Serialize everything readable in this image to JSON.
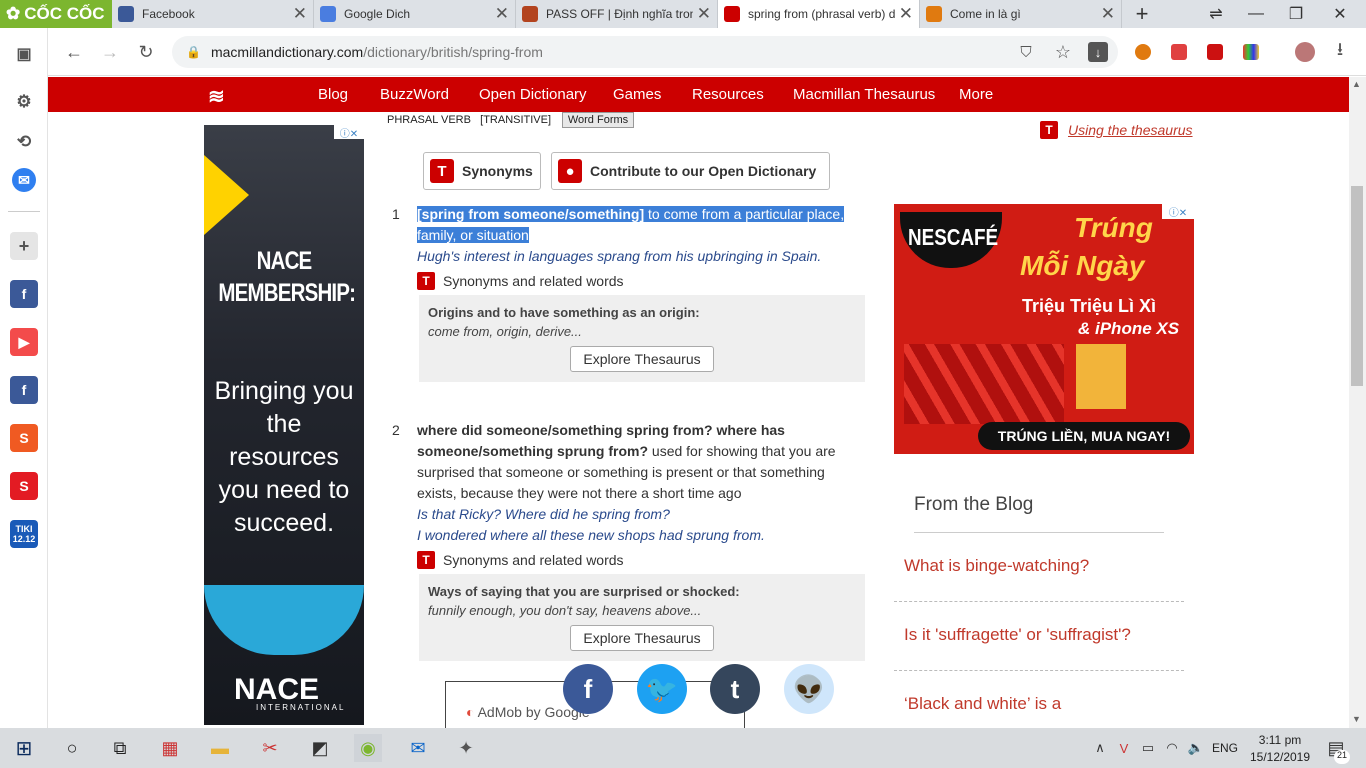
{
  "browser": {
    "brand": "CỐC CỐC",
    "tabs": [
      {
        "title": "Facebook",
        "active": false
      },
      {
        "title": "Google Dich",
        "active": false
      },
      {
        "title": "PASS OFF | Định nghĩa trong",
        "active": false
      },
      {
        "title": "spring from (phrasal verb) d",
        "active": true
      },
      {
        "title": "Come in là gì",
        "active": false
      }
    ],
    "new_tab": "+",
    "url_host": "macmillandictionary.com",
    "url_path": "/dictionary/british/spring-from"
  },
  "nav": {
    "items": [
      "Blog",
      "BuzzWord",
      "Open Dictionary",
      "Games",
      "Resources",
      "Macmillan Thesaurus",
      "More"
    ]
  },
  "entry": {
    "part_of_speech": "PHRASAL VERB",
    "grammar": "[TRANSITIVE]",
    "word_forms": "Word Forms",
    "synonyms_btn": "Synonyms",
    "contribute_btn": "Contribute to our Open Dictionary",
    "using_thesaurus": "Using the thesaurus",
    "senses": [
      {
        "num": "1",
        "pattern": "[spring from someone/something]",
        "definition": " to come from a particular place, family, or situation",
        "examples": [
          "Hugh's interest in languages sprang from his upbringing in Spain."
        ],
        "synonyms_label": "Synonyms and related words",
        "thesaurus_head": "Origins and to have something as an origin:",
        "thesaurus_words": "come from, origin, derive...",
        "explore": "Explore Thesaurus"
      },
      {
        "num": "2",
        "pattern_a": "where did someone/something spring from? where has",
        "pattern_b": "someone/something sprung from?",
        "definition_a": " used for showing that you are",
        "definition_b": "surprised that someone or something is present or that something",
        "definition_c": "exists, because they were not there a short time ago",
        "examples": [
          "Is that Ricky? Where did he spring from?",
          "I wondered where all these new shops had sprung from."
        ],
        "synonyms_label": "Synonyms and related words",
        "thesaurus_head": "Ways of saying that you are surprised or shocked:",
        "thesaurus_words": "funnily enough, you don't say, heavens above...",
        "explore": "Explore Thesaurus"
      }
    ]
  },
  "ad_left": {
    "headline": "NACE MEMBERSHIP:",
    "body": "Bringing you the resources you need to succeed.",
    "logo": "NACE",
    "logo_sub": "INTERNATIONAL"
  },
  "ad_right": {
    "brand": "NESCAFÉ",
    "line1": "Trúng",
    "line2": "Mỗi Ngày",
    "line3": "Triệu Triệu Lì Xì",
    "line4": "& iPhone XS",
    "cta": "TRÚNG LIỀN, MUA NGAY!"
  },
  "blog": {
    "title": "From the Blog",
    "links": [
      "What is binge-watching?",
      "Is it 'suffragette' or 'suffragist'?",
      "‘Black and white’ is a"
    ]
  },
  "admob": "AdMob by Google",
  "taskbar": {
    "lang": "ENG",
    "time": "3:11 pm",
    "date": "15/12/2019",
    "notif": "21"
  },
  "colors": {
    "accent": "#cc0000",
    "highlight": "#3c7fd8"
  }
}
